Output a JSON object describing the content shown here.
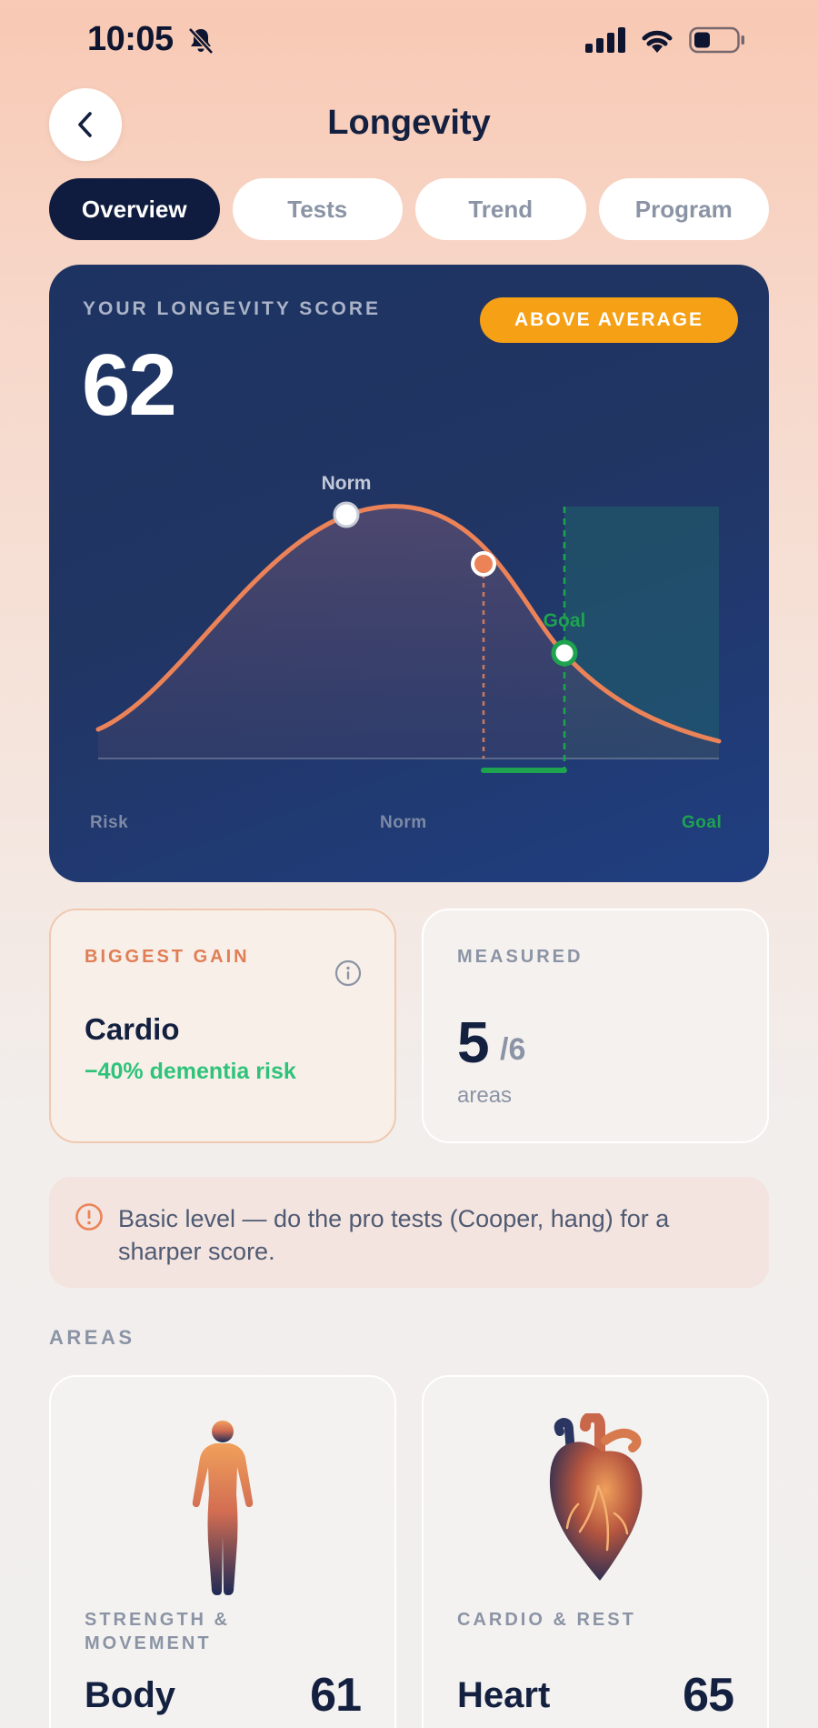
{
  "status_bar": {
    "time": "10:05"
  },
  "header": {
    "title": "Longevity",
    "back_icon": "chevron-left-icon"
  },
  "tabs": [
    {
      "label": "Overview",
      "active": true
    },
    {
      "label": "Tests",
      "active": false
    },
    {
      "label": "Trend",
      "active": false
    },
    {
      "label": "Program",
      "active": false
    }
  ],
  "score_card": {
    "label": "YOUR LONGEVITY SCORE",
    "score": "62",
    "badge": "ABOVE AVERAGE",
    "curve": {
      "norm_label": "Norm",
      "goal_label": "Goal",
      "axis_labels": {
        "left": "Risk",
        "center": "Norm",
        "right": "Goal"
      },
      "colors": {
        "curve": "#ec8358",
        "goal": "#1ea34f",
        "badge": "#f5a015"
      }
    }
  },
  "biggest_gain": {
    "kicker": "BIGGEST GAIN",
    "title": "Cardio",
    "subtitle": "−40% dementia risk",
    "icon": "info-icon"
  },
  "measured": {
    "kicker": "MEASURED",
    "value": "5",
    "total": "/6",
    "unit": "areas"
  },
  "notice": {
    "icon": "info-icon",
    "text": "Basic level — do the pro tests (Cooper, hang) for a sharper score."
  },
  "areas": {
    "title": "AREAS",
    "items": [
      {
        "kicker": "STRENGTH & MOVEMENT",
        "name": "Body",
        "score": "61",
        "icon": "body-figure-icon"
      },
      {
        "kicker": "CARDIO & REST",
        "name": "Heart",
        "score": "65",
        "icon": "heart-organ-icon"
      }
    ]
  }
}
